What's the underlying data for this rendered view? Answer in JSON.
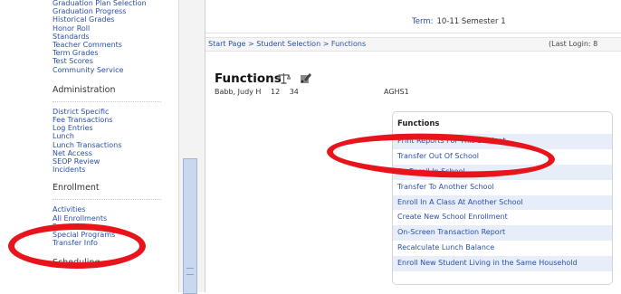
{
  "sidebar": {
    "top_links": [
      "Graduation Plan Selection",
      "Graduation Progress",
      "Historical Grades",
      "Honor Roll",
      "Standards",
      "Teacher Comments",
      "Term Grades",
      "Test Scores",
      "Community Service"
    ],
    "admin_head": "Administration",
    "admin_links": [
      "District Specific",
      "Fee Transactions",
      "Log Entries",
      "Lunch",
      "Lunch Transactions",
      "Net Access",
      "SEOP Review",
      "Incidents"
    ],
    "enroll_head": "Enrollment",
    "enroll_links": [
      "Activities",
      "All Enrollments",
      "Functions",
      "Special Programs",
      "Transfer Info"
    ],
    "sched_head": "Scheduling"
  },
  "header": {
    "term_label": "Term:",
    "term_value": "10-11 Semester 1",
    "breadcrumb": "Start Page > Student Selection > Functions",
    "last_login": "(Last Login: 8"
  },
  "page": {
    "title": "Functions",
    "student_name": "Babb, Judy H",
    "grade": "12",
    "number": "34",
    "school": "AGHS1",
    "icons": [
      "scales-icon",
      "edit-icon"
    ]
  },
  "functions": {
    "header": "Functions",
    "items": [
      "Print Reports For This Student",
      "Transfer Out Of School",
      "Re-Enroll In School",
      "Transfer To Another School",
      "Enroll In A Class At Another School",
      "Create New School Enrollment",
      "On-Screen Transaction Report",
      "Recalculate Lunch Balance",
      "Enroll New Student Living in the Same Household"
    ]
  },
  "colors": {
    "link": "#2a4fa8",
    "annotation": "#e8141b",
    "row_alt": "#e7eef9"
  }
}
